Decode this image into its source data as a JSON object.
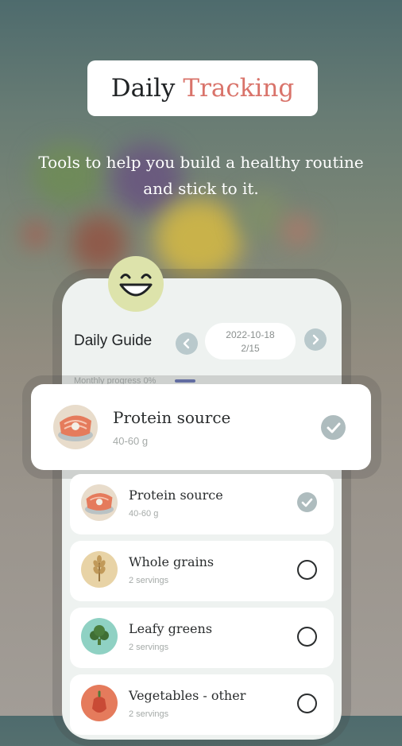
{
  "promo": {
    "title_word1": "Daily",
    "title_word2": "Tracking",
    "tagline_line1": "Tools to help you build a healthy routine",
    "tagline_line2": "and stick to it.",
    "accent_color": "#d9736a"
  },
  "daily_guide": {
    "title": "Daily Guide",
    "date": "2022-10-18",
    "progress": "2/15",
    "monthly_label": "Monthly progress",
    "monthly_value": "0%"
  },
  "featured_item": {
    "name": "Protein source",
    "amount": "40-60 g",
    "checked": true,
    "icon": "salmon-icon"
  },
  "items": [
    {
      "name": "Protein source",
      "amount": "40-60 g",
      "checked": true,
      "icon": "salmon-icon"
    },
    {
      "name": "Whole grains",
      "amount": "2 servings",
      "checked": false,
      "icon": "wheat-icon"
    },
    {
      "name": "Leafy greens",
      "amount": "2 servings",
      "checked": false,
      "icon": "broccoli-icon"
    },
    {
      "name": "Vegetables - other",
      "amount": "2 servings",
      "checked": false,
      "icon": "pepper-icon"
    }
  ]
}
